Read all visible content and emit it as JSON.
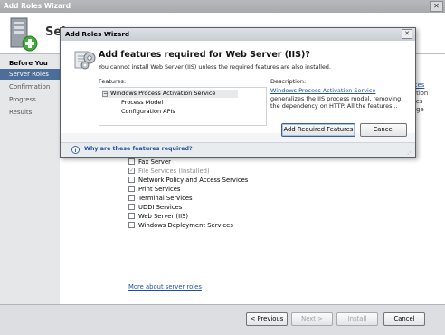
{
  "window": {
    "title": "Add Roles Wizard",
    "close_glyph": "✕",
    "header_title": "Sel"
  },
  "nav": {
    "items": [
      {
        "label": "Before You Begin"
      },
      {
        "label": "Server Roles"
      },
      {
        "label": "Confirmation"
      },
      {
        "label": "Progress"
      },
      {
        "label": "Results"
      }
    ]
  },
  "roles": [
    {
      "label": "Fax Server",
      "checked": false
    },
    {
      "label": "File Services  (Installed)",
      "checked": true
    },
    {
      "label": "Network Policy and Access Services",
      "checked": false
    },
    {
      "label": "Print Services",
      "checked": false
    },
    {
      "label": "Terminal Services",
      "checked": false
    },
    {
      "label": "UDDI Services",
      "checked": false
    },
    {
      "label": "Web Server (IIS)",
      "checked": false
    },
    {
      "label": "Windows Deployment Services",
      "checked": false
    }
  ],
  "side_text": {
    "line1": "ices",
    "line2": "ation",
    "line3": "ces",
    "line4": "age"
  },
  "more_link": "More about server roles",
  "footer_buttons": {
    "previous": "< Previous",
    "next": "Next >",
    "install": "Install",
    "cancel": "Cancel"
  },
  "dialog": {
    "title": "Add Roles Wizard",
    "close_glyph": "✕",
    "heading": "Add features required for Web Server (IIS)?",
    "subtext": "You cannot install Web Server (IIS) unless the required features are also installed.",
    "features_label": "Features:",
    "description_label": "Description:",
    "features": {
      "parent": "Windows Process Activation Service",
      "toggle": "−",
      "children": [
        "Process Model",
        "Configuration APIs"
      ]
    },
    "description_link": "Windows Process Activation Service",
    "description_text": "generalizes the IIS process model, removing the dependency on HTTP. All the features...",
    "add_button": "Add Required Features",
    "cancel_button": "Cancel",
    "why_link": "Why are these features required?",
    "info_glyph": "i"
  }
}
